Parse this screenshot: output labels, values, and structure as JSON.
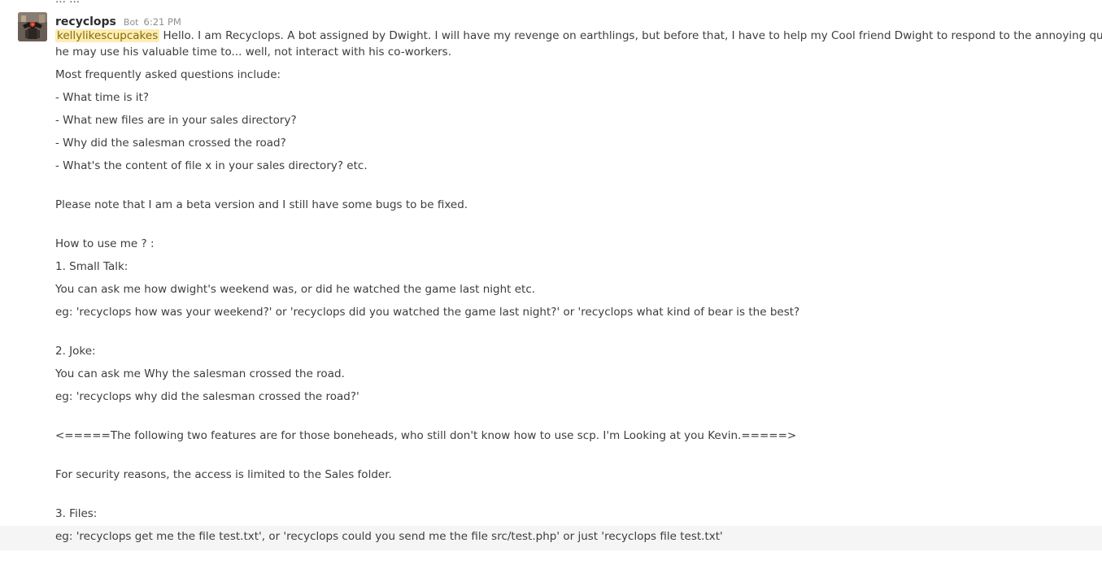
{
  "previous_message_tail": "... ...",
  "message": {
    "sender": "recyclops",
    "bot_tag": "Bot",
    "timestamp": "6:21 PM",
    "avatar_icon": "robot-avatar-icon",
    "mention": "kellylikescupcakes",
    "intro_line1": "Hello. I am Recyclops. A bot assigned by Dwight. I will have my revenge on earthlings, but before that, I have to help my Cool friend Dwight to respond to the annoying questions asked by his co-workers, so",
    "intro_line2": "he may use his valuable time to... well, not interact with his co-workers.",
    "faq_heading": "Most frequently asked questions include:",
    "faq_items": [
      "- What time is it?",
      "- What new files are in your sales directory?",
      "- Why did the salesman crossed the road?",
      "- What's the content of file x in your sales directory? etc."
    ],
    "beta_note": "Please note that I am a beta version and I still have some bugs to be fixed.",
    "how_to_heading": "How to use me ? :",
    "small_talk_title": "1. Small Talk:",
    "small_talk_desc": "You can ask me how dwight's weekend was, or did he watched the game last night etc.",
    "small_talk_example": "eg: 'recyclops how was your weekend?' or 'recyclops did you watched the game last night?' or 'recyclops what kind of bear is the best?",
    "joke_title": "2. Joke:",
    "joke_desc": "You can ask me Why the salesman crossed the road.",
    "joke_example": "eg: 'recyclops why did the salesman crossed the road?'",
    "separator_line": "<=====The following two features are for those boneheads, who still don't know how to use scp. I'm Looking at you Kevin.=====>",
    "security_note": "For security reasons, the access is limited to the Sales folder.",
    "files_title": "3. Files:",
    "files_example": "eg: 'recyclops get me the file test.txt', or 'recyclops could you send me the file src/test.php' or just 'recyclops file test.txt'"
  }
}
